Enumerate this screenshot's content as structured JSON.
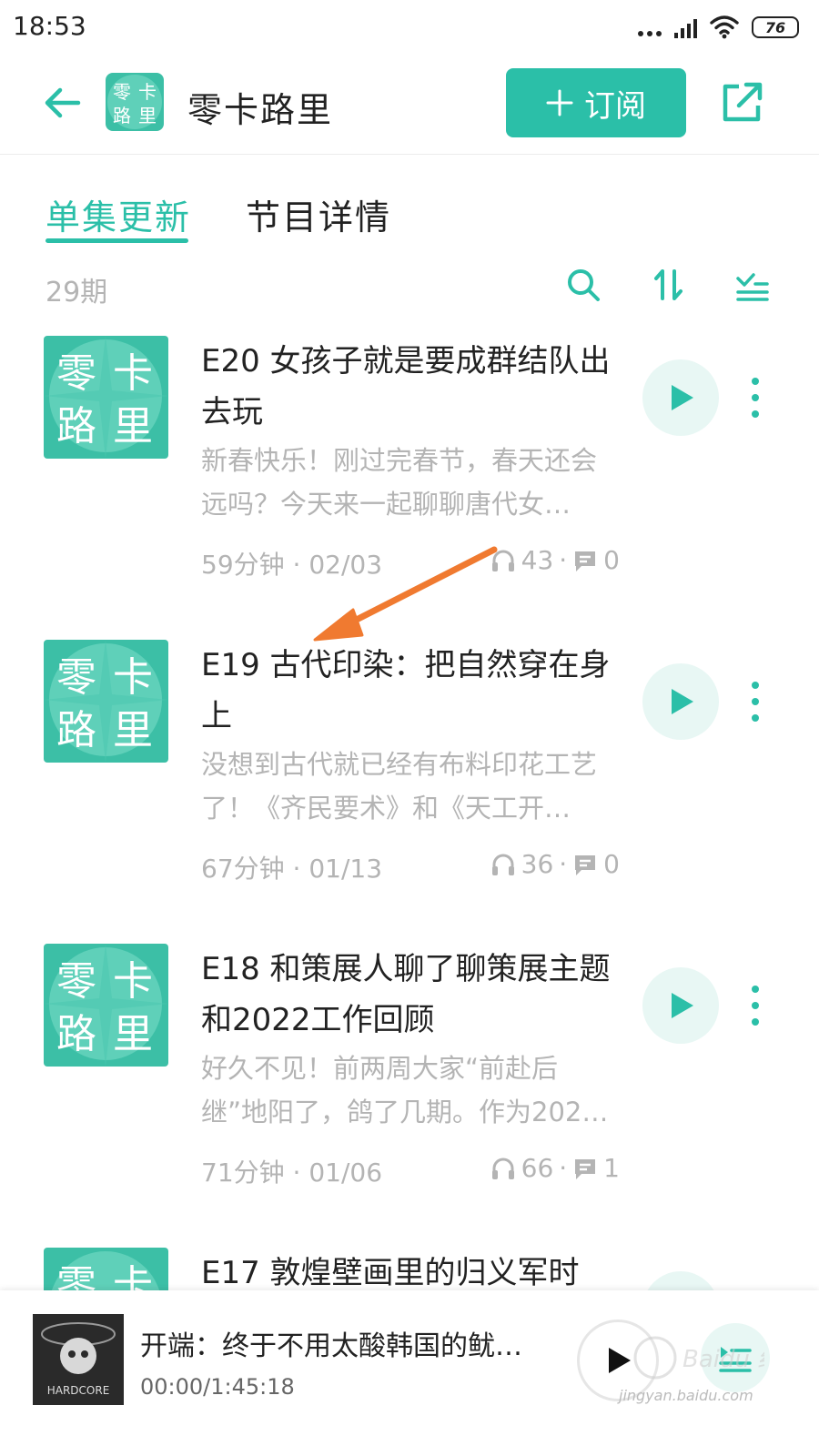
{
  "status_bar": {
    "time": "18:53",
    "battery": "76"
  },
  "header": {
    "title": "零卡路里",
    "subscribe_label": "订阅",
    "logo_text": [
      "零",
      "卡",
      "路",
      "里"
    ]
  },
  "tabs": [
    {
      "label": "单集更新",
      "active": true
    },
    {
      "label": "节目详情",
      "active": false
    }
  ],
  "episode_count": "29期",
  "episodes": [
    {
      "title": "E20 女孩子就是要成群结队出去玩",
      "description": "新春快乐！刚过完春节，春天还会远吗？今天来一起聊聊唐代女…",
      "duration_date": "59分钟 · 02/03",
      "listens": "43",
      "comments": "0"
    },
    {
      "title": "E19 古代印染：把自然穿在身上",
      "description": "没想到古代就已经有布料印花工艺了！《齐民要术》和《天工开…",
      "duration_date": "67分钟 · 01/13",
      "listens": "36",
      "comments": "0"
    },
    {
      "title": "E18 和策展人聊了聊策展主题和2022工作回顾",
      "description": "好久不见！前两周大家“前赴后继”地阳了，鸽了几期。作为202…",
      "duration_date": "71分钟 · 01/06",
      "listens": "66",
      "comments": "1"
    },
    {
      "title": "E17 敦煌壁画里的归义军时",
      "description": "",
      "duration_date": "",
      "listens": "",
      "comments": ""
    }
  ],
  "player": {
    "title": "开端：终于不用太酸韩国的鱿…",
    "time": "00:00/1:45:18",
    "cover_text": "HARDCORE"
  },
  "colors": {
    "accent": "#2bbfa8",
    "accent_light": "#e8f7f4",
    "annotation": "#f07a30",
    "muted_text": "#b4b4b4"
  },
  "icons": {
    "back": "arrow-left-icon",
    "share": "share-icon",
    "search": "search-icon",
    "sort": "sort-icon",
    "filter": "filter-list-icon",
    "play": "play-icon",
    "more": "more-vertical-icon",
    "headphones": "headphones-icon",
    "comment": "comment-icon",
    "playlist": "playlist-icon"
  },
  "watermark": {
    "text": "Baidu 经验",
    "url_text": "jingyan.baidu.com"
  }
}
